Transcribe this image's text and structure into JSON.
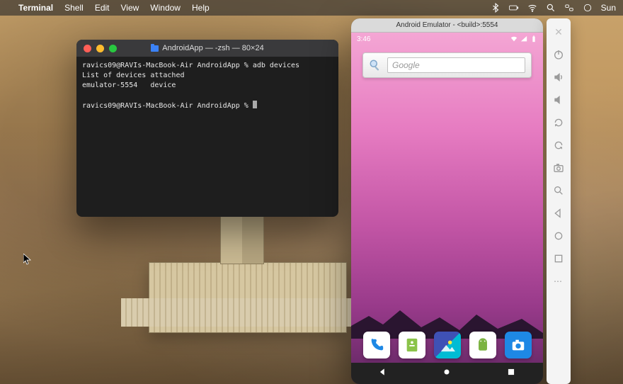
{
  "menubar": {
    "app": "Terminal",
    "items": [
      "Shell",
      "Edit",
      "View",
      "Window",
      "Help"
    ],
    "clock": "Sun"
  },
  "terminal": {
    "title": "AndroidApp — -zsh — 80×24",
    "lines": [
      "ravics09@RAVIs-MacBook-Air AndroidApp % adb devices",
      "List of devices attached",
      "emulator-5554   device",
      "",
      "ravics09@RAVIs-MacBook-Air AndroidApp % "
    ]
  },
  "emulator": {
    "title": "Android Emulator - <build>:5554",
    "clock": "3:46",
    "search_placeholder": "Google",
    "dock": {
      "phone": "Phone",
      "messages": "Messages",
      "gallery": "Gallery",
      "android": "Android",
      "camera": "Camera"
    },
    "toolbar": {
      "close": "Close",
      "power": "Power",
      "vol_up": "Volume up",
      "vol_down": "Volume down",
      "rotate_left": "Rotate left",
      "rotate_right": "Rotate right",
      "screenshot": "Screenshot",
      "zoom": "Zoom",
      "back": "Back",
      "home": "Home",
      "overview": "Overview",
      "more": "More"
    }
  }
}
